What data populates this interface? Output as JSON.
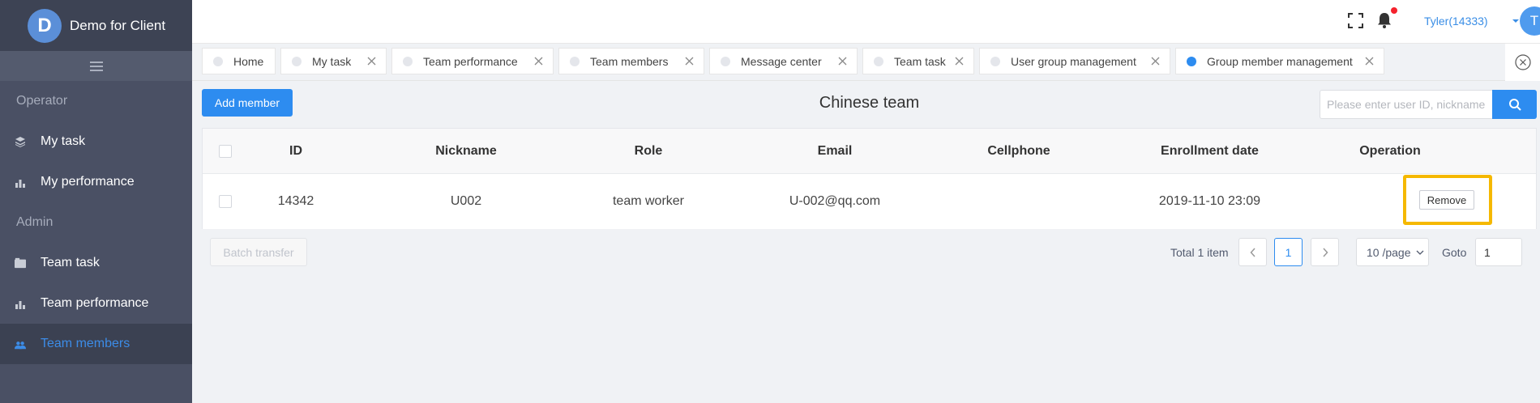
{
  "brand": {
    "initial": "D",
    "name": "Demo for Client"
  },
  "sidebar": {
    "sections": [
      {
        "label": "Operator",
        "items": [
          {
            "label": "My task",
            "icon": "layers-icon"
          },
          {
            "label": "My performance",
            "icon": "bar-chart-icon"
          }
        ]
      },
      {
        "label": "Admin",
        "items": [
          {
            "label": "Team task",
            "icon": "folder-icon"
          },
          {
            "label": "Team performance",
            "icon": "bar-chart-icon"
          },
          {
            "label": "Team members",
            "icon": "users-icon",
            "active": true
          }
        ]
      }
    ]
  },
  "header": {
    "user": "Tyler(14333)",
    "avatar_initial": "T",
    "notification_badge": true
  },
  "tabs": [
    {
      "label": "Home",
      "closable": false
    },
    {
      "label": "My task",
      "closable": true
    },
    {
      "label": "Team performance",
      "closable": true
    },
    {
      "label": "Team members",
      "closable": true
    },
    {
      "label": "Message center",
      "closable": true
    },
    {
      "label": "Team task",
      "closable": true
    },
    {
      "label": "User group management",
      "closable": true
    },
    {
      "label": "Group member management",
      "closable": true,
      "active": true
    }
  ],
  "toolbar": {
    "add_label": "Add member",
    "title": "Chinese team",
    "search_placeholder": "Please enter user ID, nickname"
  },
  "table": {
    "columns": [
      "ID",
      "Nickname",
      "Role",
      "Email",
      "Cellphone",
      "Enrollment date",
      "Operation"
    ],
    "rows": [
      {
        "id": "14342",
        "nickname": "U002",
        "role": "team worker",
        "email": "U-002@qq.com",
        "cellphone": "",
        "enrollment_date": "2019-11-10 23:09",
        "action": "Remove"
      }
    ]
  },
  "footer": {
    "batch_label": "Batch transfer",
    "total": "Total 1 item",
    "current_page": "1",
    "page_size": "10 /page",
    "goto_label": "Goto",
    "goto_value": "1"
  },
  "colors": {
    "accent": "#2d8cf0",
    "sidebar": "#4a5064",
    "highlight": "#f5b800"
  }
}
